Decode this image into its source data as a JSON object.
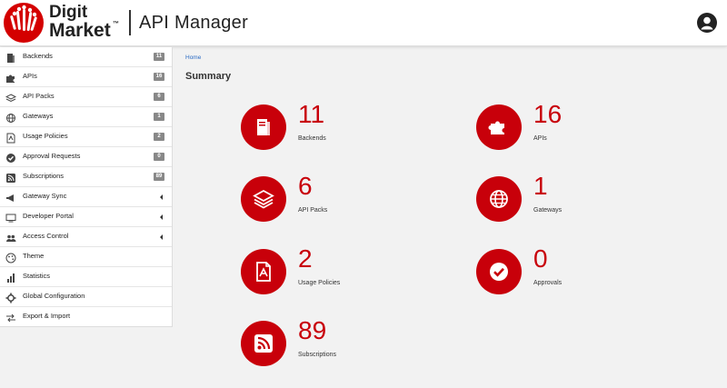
{
  "header": {
    "logo_line1": "Digit",
    "logo_line2": "Market",
    "logo_tm": "™",
    "app_title": "API Manager"
  },
  "sidebar": {
    "items": [
      {
        "label": "Backends",
        "badge": "11",
        "icon": "server-icon"
      },
      {
        "label": "APIs",
        "badge": "16",
        "icon": "puzzle-icon"
      },
      {
        "label": "API Packs",
        "badge": "6",
        "icon": "layers-icon"
      },
      {
        "label": "Gateways",
        "badge": "1",
        "icon": "globe-icon"
      },
      {
        "label": "Usage Policies",
        "badge": "2",
        "icon": "policy-icon"
      },
      {
        "label": "Approval Requests",
        "badge": "0",
        "icon": "check-circle-icon"
      },
      {
        "label": "Subscriptions",
        "badge": "89",
        "icon": "rss-icon"
      },
      {
        "label": "Gateway Sync",
        "icon": "megaphone-icon",
        "expandable": true
      },
      {
        "label": "Developer Portal",
        "icon": "monitor-icon",
        "expandable": true
      },
      {
        "label": "Access Control",
        "icon": "users-icon",
        "expandable": true
      },
      {
        "label": "Theme",
        "icon": "palette-icon"
      },
      {
        "label": "Statistics",
        "icon": "bar-chart-icon"
      },
      {
        "label": "Global Configuration",
        "icon": "gear-icon"
      },
      {
        "label": "Export & Import",
        "icon": "exchange-icon"
      }
    ]
  },
  "breadcrumb": {
    "home": "Home"
  },
  "page_title": "Summary",
  "cards": [
    {
      "count": "11",
      "label": "Backends",
      "icon": "server-icon"
    },
    {
      "count": "16",
      "label": "APIs",
      "icon": "puzzle-icon"
    },
    {
      "count": "6",
      "label": "API Packs",
      "icon": "layers-icon"
    },
    {
      "count": "1",
      "label": "Gateways",
      "icon": "globe-icon"
    },
    {
      "count": "2",
      "label": "Usage Policies",
      "icon": "policy-icon"
    },
    {
      "count": "0",
      "label": "Approvals",
      "icon": "check-circle-icon"
    },
    {
      "count": "89",
      "label": "Subscriptions",
      "icon": "rss-icon"
    }
  ],
  "colors": {
    "accent": "#c8000a",
    "badge": "#888888",
    "link": "#2a6bc4"
  }
}
